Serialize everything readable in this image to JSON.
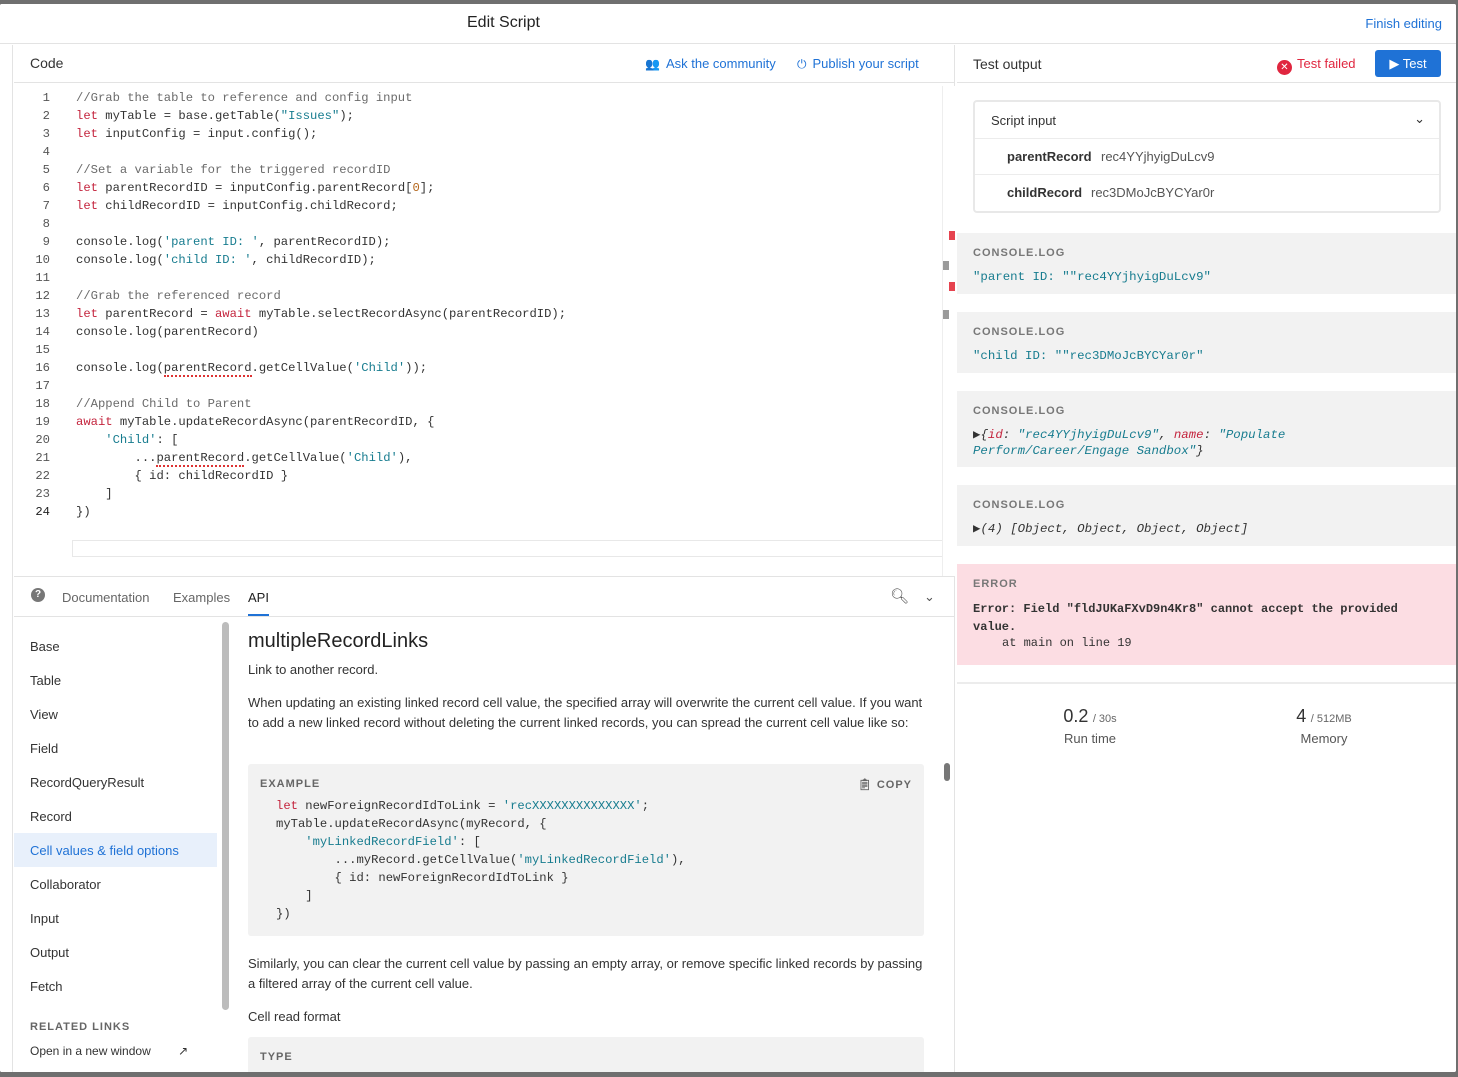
{
  "header": {
    "title": "Edit Script",
    "finish": "Finish editing"
  },
  "code": {
    "label": "Code",
    "ask_community": "Ask the community",
    "publish": "Publish your script"
  },
  "docs": {
    "tabs": [
      "Documentation",
      "Examples",
      "API"
    ],
    "nav": [
      "Base",
      "Table",
      "View",
      "Field",
      "RecordQueryResult",
      "Record",
      "Cell values & field options",
      "Collaborator",
      "Input",
      "Output",
      "Fetch"
    ],
    "related_links": "RELATED LINKS",
    "open_new_window": "Open in a new window",
    "heading": "multipleRecordLinks",
    "p1": "Link to another record.",
    "p2": "When updating an existing linked record cell value, the specified array will overwrite the current cell value. If you want to add a new linked record without deleting the current linked records, you can spread the current cell value like so:",
    "example_label": "EXAMPLE",
    "copy_label": "COPY",
    "p3": "Similarly, you can clear the current cell value by passing an empty array, or remove specific linked records by passing a filtered array of the current cell value.",
    "p4": "Cell read format",
    "type_label": "TYPE"
  },
  "output": {
    "label": "Test output",
    "status": "Test failed",
    "test_button": "Test",
    "script_input": "Script input",
    "inputs": [
      {
        "key": "parentRecord",
        "value": "rec4YYjhyigDuLcv9"
      },
      {
        "key": "childRecord",
        "value": "rec3DMoJcBYCYar0r"
      }
    ],
    "logs": [
      {
        "label": "CONSOLE.LOG",
        "value": "\"parent ID: \"\"rec4YYjhyigDuLcv9\""
      },
      {
        "label": "CONSOLE.LOG",
        "value": "\"child ID: \"\"rec3DMoJcBYCYar0r\""
      },
      {
        "label": "CONSOLE.LOG"
      },
      {
        "label": "CONSOLE.LOG"
      }
    ],
    "error_label": "ERROR",
    "error_msg": "Error: Field \"fldJUKaFXvD9n4Kr8\" cannot accept the provided\nvalue.",
    "error_at": "at main on line 19",
    "runtime_value": "0.2",
    "runtime_limit": "/ 30s",
    "runtime_caption": "Run time",
    "memory_value": "4",
    "memory_limit": "/ 512MB",
    "memory_caption": "Memory"
  },
  "colors": {
    "accent": "#1f72d6",
    "error": "#e0263f",
    "error_bg": "#fcdde3"
  }
}
